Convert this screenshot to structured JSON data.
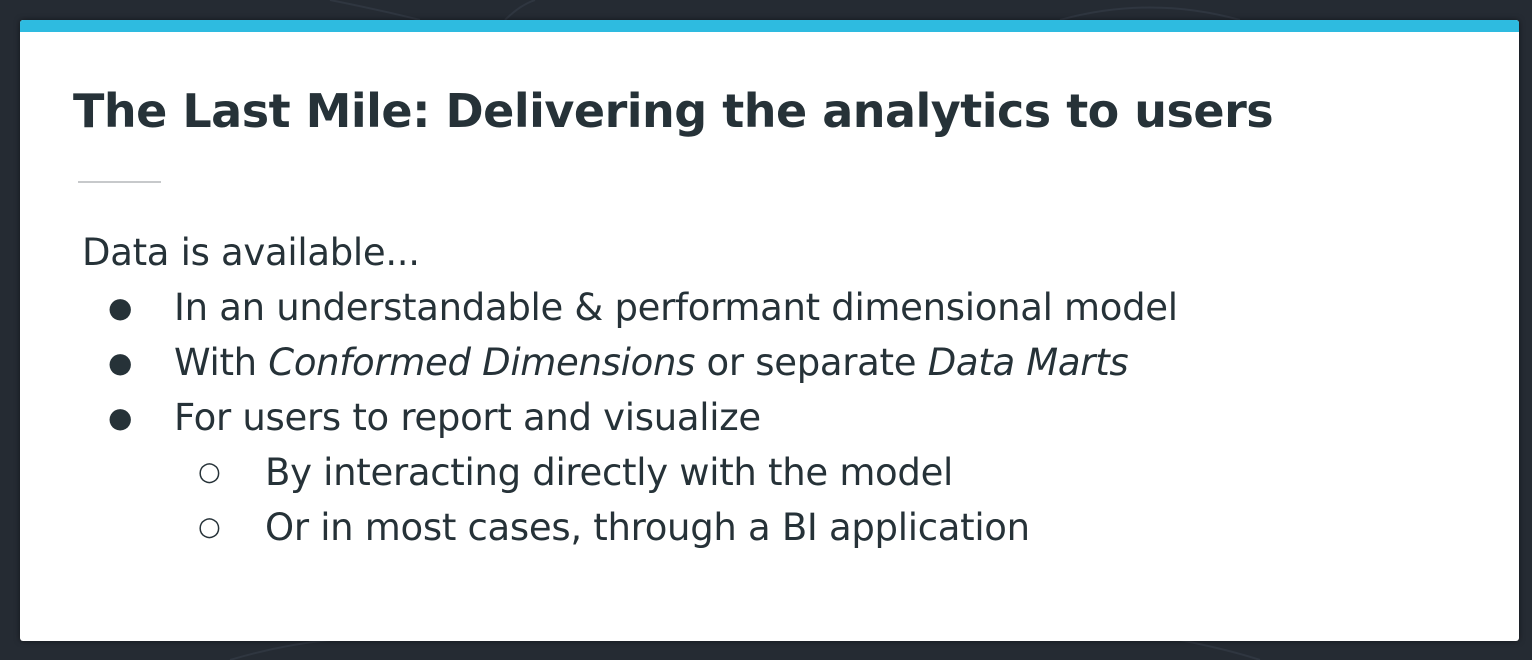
{
  "colors": {
    "background": "#252b33",
    "slide": "#ffffff",
    "accent": "#2ebbe0",
    "text": "#263238",
    "divider": "#c7c9cb"
  },
  "slide": {
    "title": "The Last Mile: Delivering the analytics to users",
    "intro": "Data is available...",
    "bullets": [
      {
        "marker": "●",
        "text": "In an understandable & performant dimensional model"
      },
      {
        "marker": "●",
        "parts": [
          "With ",
          "Conformed Dimensions",
          " or separate ",
          "Data Marts"
        ]
      },
      {
        "marker": "●",
        "text": "For users to report and visualize",
        "sub_bullets": [
          {
            "marker": "○",
            "text": "By interacting directly with the model"
          },
          {
            "marker": "○",
            "text": "Or in most cases, through a BI application"
          }
        ]
      }
    ]
  }
}
